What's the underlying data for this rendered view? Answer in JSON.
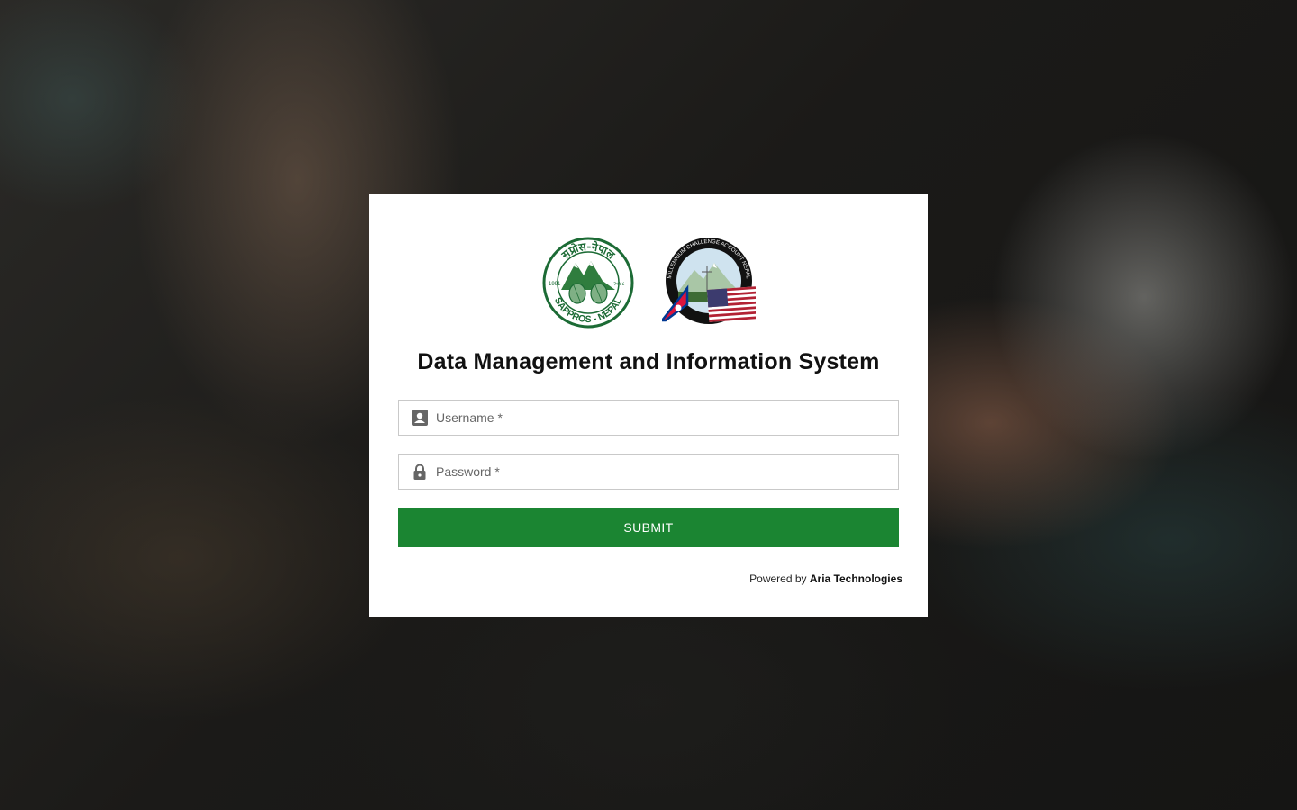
{
  "logos": {
    "left": {
      "name": "sappros-nepal-logo",
      "top_text": "सप्रोस-नेपाल",
      "bottom_text": "SAPPROS - NEPAL",
      "year_left": "1991",
      "year_right": "२०४८"
    },
    "right": {
      "name": "mcc-nepal-logo",
      "ring_text": "MILLENNIUM CHALLENGE ACCOUNT NEPAL"
    }
  },
  "title": "Data Management and Information System",
  "form": {
    "username_placeholder": "Username *",
    "password_placeholder": "Password *",
    "submit_label": "SUBMIT"
  },
  "footer": {
    "powered_prefix": "Powered by",
    "powered_brand": "Aria Technologies"
  },
  "colors": {
    "accent": "#1b8532",
    "card_bg": "#ffffff",
    "input_border": "#c9c9c9",
    "icon": "#666666"
  },
  "icons": {
    "username": "contact-card-icon",
    "password": "lock-icon"
  }
}
